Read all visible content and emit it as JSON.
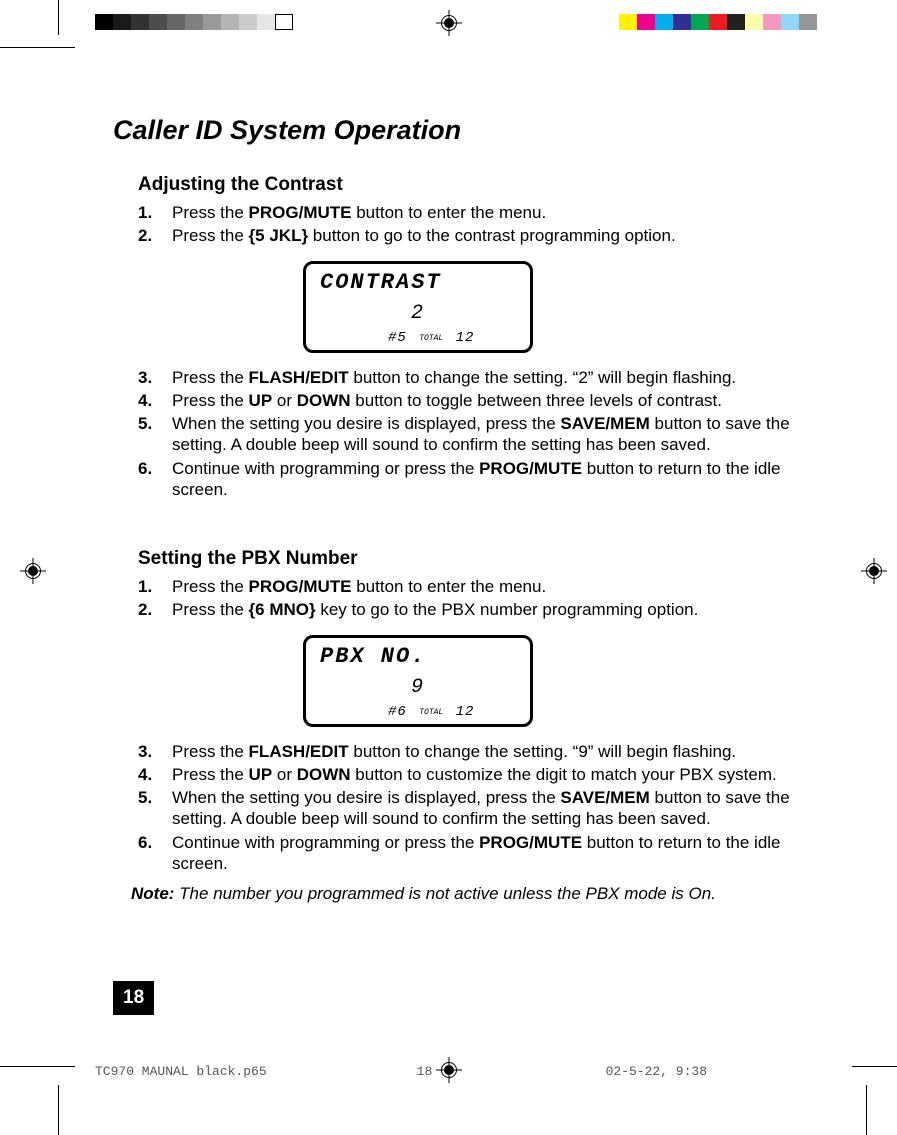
{
  "colorbar": {
    "left_set": [
      "#000000",
      "#1a1a1a",
      "#333333",
      "#4d4d4d",
      "#666666",
      "#808080",
      "#999999",
      "#b3b3b3",
      "#cccccc",
      "#e6e6e6",
      "#ffffff"
    ],
    "right_set": [
      "#fff200",
      "#ec008c",
      "#00aeef",
      "#2e3192",
      "#00a651",
      "#ed1c24",
      "#231f20",
      "#fffbae",
      "#f49ac1",
      "#8ed8f8",
      "#949599"
    ]
  },
  "title": "Caller ID System Operation",
  "section1": {
    "heading": "Adjusting the Contrast",
    "steps": [
      {
        "n": "1.",
        "t": "Press the <b>PROG/MUTE</b> button to enter the menu."
      },
      {
        "n": "2.",
        "t": "Press the <b>{5 JKL}</b> button to go to the contrast  programming option."
      },
      {
        "n": "3.",
        "t": "Press the <b>FLASH/EDIT</b> button to change the setting. “2” will begin flashing."
      },
      {
        "n": "4.",
        "t": "Press the  <b>UP</b>  or  <b>DOWN</b>  button to toggle between three levels of contrast."
      },
      {
        "n": "5.",
        "t": "When the setting you desire is displayed, press the <b>SAVE/MEM</b> button to save the setting. A double beep will sound to confirm the setting has been saved."
      },
      {
        "n": "6.",
        "t": "Continue with programming or press the <b>PROG/MUTE</b> button to return to the idle screen."
      }
    ],
    "lcd": {
      "line1": "CONTRAST",
      "line2": "2",
      "line3_left": "#5",
      "line3_total_label": "TOTAL",
      "line3_right": "12"
    }
  },
  "section2": {
    "heading": "Setting the PBX Number",
    "steps": [
      {
        "n": "1.",
        "t": "Press the <b>PROG/MUTE</b> button to enter the menu."
      },
      {
        "n": "2.",
        "t": "Press the <b>{6 MNO}</b> key to go to the PBX number programming option."
      },
      {
        "n": "3.",
        "t": "Press the <b>FLASH/EDIT</b> button to change the setting. “9” will begin flashing."
      },
      {
        "n": "4.",
        "t": "Press the <b>UP</b> or <b>DOWN</b> button to customize the digit to match your PBX system."
      },
      {
        "n": "5.",
        "t": "When the setting you desire is displayed, press the <b>SAVE/MEM</b> button to save the setting. A double beep will sound to confirm the setting has been saved."
      },
      {
        "n": "6.",
        "t": "Continue with programming or press the <b>PROG/MUTE</b> button to return to the idle screen."
      }
    ],
    "lcd": {
      "line1": "PBX NO.",
      "line2": "9",
      "line3_left": "#6",
      "line3_total_label": "TOTAL",
      "line3_right": "12"
    },
    "note_label": "Note:",
    "note_text": " The number you programmed is not active unless the PBX mode is On."
  },
  "page_number": "18",
  "footer": {
    "filename": "TC970 MAUNAL black.p65",
    "page": "18",
    "datetime": "02-5-22, 9:38"
  }
}
